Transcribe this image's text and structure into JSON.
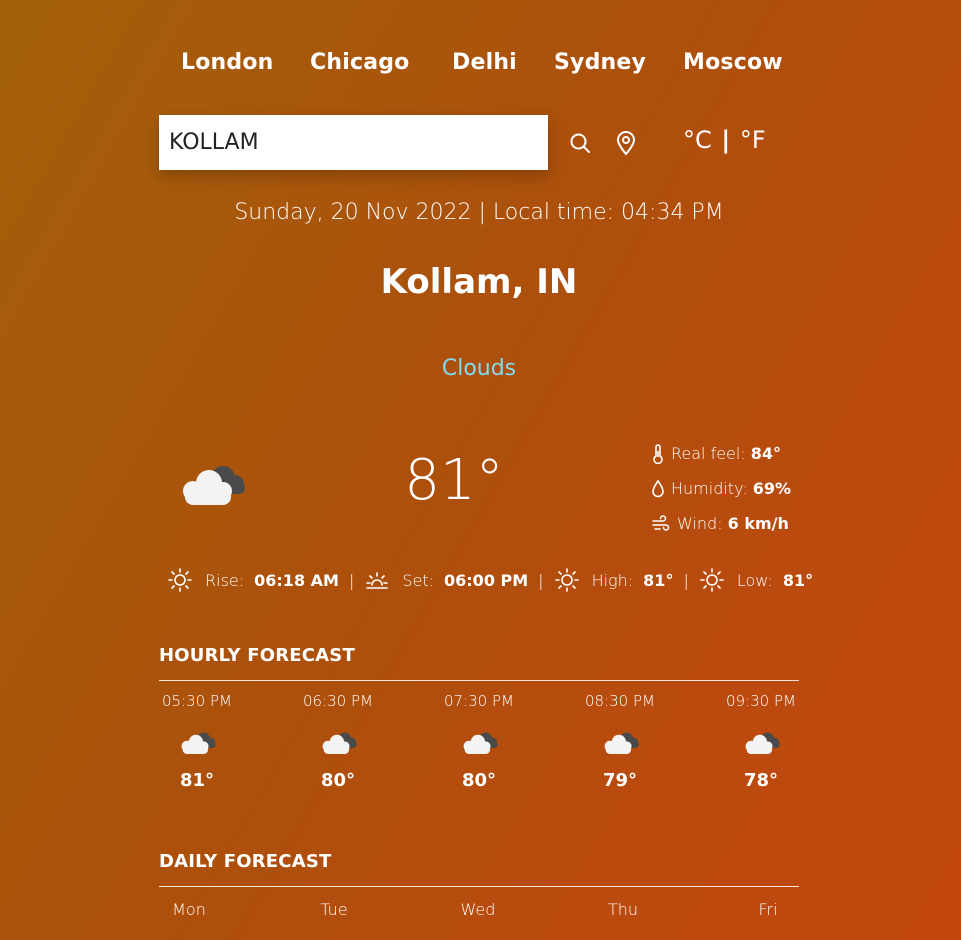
{
  "cities": [
    "London",
    "Chicago",
    "Delhi",
    "Sydney",
    "Moscow"
  ],
  "search": {
    "value": "KOLLAM"
  },
  "icons": {
    "search": "search-icon",
    "location": "location-pin-icon",
    "cloud": "cloud-icon",
    "thermometer": "thermometer-icon",
    "droplet": "droplet-icon",
    "wind": "wind-icon",
    "sun": "sun-icon",
    "sunset": "sunset-icon"
  },
  "units": {
    "celsius": "°C",
    "separator": "|",
    "fahrenheit": "°F"
  },
  "datetime": "Sunday, 20 Nov 2022 | Local time: 04:34 PM",
  "location": "Kollam, IN",
  "condition": "Clouds",
  "condition_color": "#7fdcf0",
  "temperature": "81°",
  "details": {
    "real_feel_label": "Real feel:",
    "real_feel_value": "84°",
    "humidity_label": "Humidity:",
    "humidity_value": "69%",
    "wind_label": "Wind:",
    "wind_value": "6 km/h"
  },
  "sun": {
    "rise_label": "Rise:",
    "rise_value": "06:18 AM",
    "set_label": "Set:",
    "set_value": "06:00 PM",
    "high_label": "High:",
    "high_value": "81°",
    "low_label": "Low:",
    "low_value": "81°",
    "pipe": "|"
  },
  "hourly_title": "HOURLY FORECAST",
  "hourly": [
    {
      "time": "05:30 PM",
      "temp": "81°"
    },
    {
      "time": "06:30 PM",
      "temp": "80°"
    },
    {
      "time": "07:30 PM",
      "temp": "80°"
    },
    {
      "time": "08:30 PM",
      "temp": "79°"
    },
    {
      "time": "09:30 PM",
      "temp": "78°"
    }
  ],
  "daily_title": "DAILY FORECAST",
  "daily": [
    {
      "day": "Mon"
    },
    {
      "day": "Tue"
    },
    {
      "day": "Wed"
    },
    {
      "day": "Thu"
    },
    {
      "day": "Fri"
    }
  ]
}
